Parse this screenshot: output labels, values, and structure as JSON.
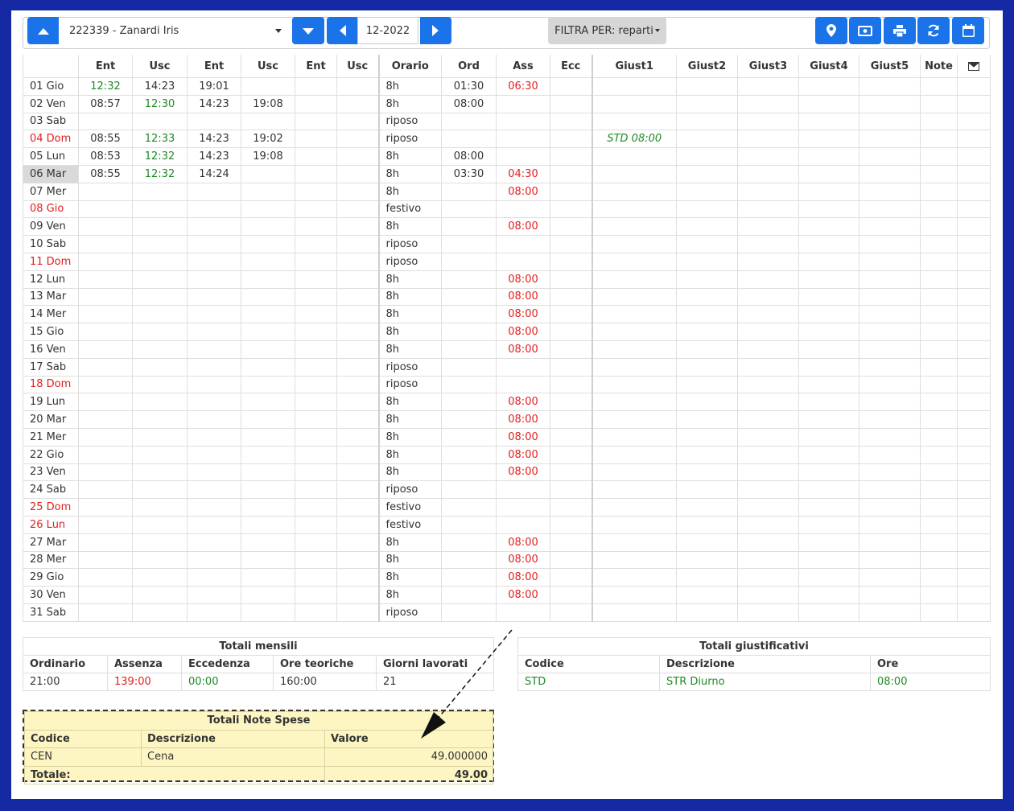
{
  "toolbar": {
    "employee": "222339 - Zanardi Iris",
    "month": "12-2022",
    "filter_label": "FILTRA PER: reparti"
  },
  "icons": {
    "up": "up-arrow-icon",
    "down": "down-arrow-icon",
    "prev": "left-arrow-icon",
    "next": "right-arrow-icon",
    "location": "map-marker-icon",
    "money": "money-bill-icon",
    "print": "print-icon",
    "refresh": "refresh-icon",
    "calendar": "calendar-icon",
    "mail": "envelope-icon"
  },
  "grid": {
    "headers": [
      "",
      "Ent",
      "Usc",
      "Ent",
      "Usc",
      "Ent",
      "Usc",
      "Orario",
      "Ord",
      "Ass",
      "Ecc",
      "Giust1",
      "Giust2",
      "Giust3",
      "Giust4",
      "Giust5",
      "Note",
      ""
    ],
    "selected_day": "06 Mar",
    "rows": [
      {
        "day": "01 Gio",
        "holiday": false,
        "e1": "12:32",
        "e1c": "green",
        "u1": "14:23",
        "e2": "19:01",
        "u2": "",
        "orario": "8h",
        "ord": "01:30",
        "ass": "06:30",
        "giust1": ""
      },
      {
        "day": "02 Ven",
        "holiday": false,
        "e1": "08:57",
        "u1": "12:30",
        "u1c": "green",
        "e2": "14:23",
        "u2": "19:08",
        "orario": "8h",
        "ord": "08:00",
        "ass": "",
        "giust1": ""
      },
      {
        "day": "03 Sab",
        "holiday": false,
        "e1": "",
        "u1": "",
        "e2": "",
        "u2": "",
        "orario": "riposo",
        "ord": "",
        "ass": "",
        "giust1": ""
      },
      {
        "day": "04 Dom",
        "holiday": true,
        "e1": "08:55",
        "u1": "12:33",
        "u1c": "green",
        "e2": "14:23",
        "u2": "19:02",
        "orario": "riposo",
        "ord": "",
        "ass": "",
        "giust1": "STD 08:00"
      },
      {
        "day": "05 Lun",
        "holiday": false,
        "e1": "08:53",
        "u1": "12:32",
        "u1c": "green",
        "e2": "14:23",
        "u2": "19:08",
        "orario": "8h",
        "ord": "08:00",
        "ass": "",
        "giust1": ""
      },
      {
        "day": "06 Mar",
        "holiday": false,
        "e1": "08:55",
        "u1": "12:32",
        "u1c": "green",
        "e2": "14:24",
        "u2": "",
        "orario": "8h",
        "ord": "03:30",
        "ass": "04:30",
        "giust1": ""
      },
      {
        "day": "07 Mer",
        "holiday": false,
        "orario": "8h",
        "ord": "",
        "ass": "08:00"
      },
      {
        "day": "08 Gio",
        "holiday": true,
        "orario": "festivo",
        "ord": "",
        "ass": ""
      },
      {
        "day": "09 Ven",
        "holiday": false,
        "orario": "8h",
        "ord": "",
        "ass": "08:00"
      },
      {
        "day": "10 Sab",
        "holiday": false,
        "orario": "riposo",
        "ord": "",
        "ass": ""
      },
      {
        "day": "11 Dom",
        "holiday": true,
        "orario": "riposo",
        "ord": "",
        "ass": ""
      },
      {
        "day": "12 Lun",
        "holiday": false,
        "orario": "8h",
        "ord": "",
        "ass": "08:00"
      },
      {
        "day": "13 Mar",
        "holiday": false,
        "orario": "8h",
        "ord": "",
        "ass": "08:00"
      },
      {
        "day": "14 Mer",
        "holiday": false,
        "orario": "8h",
        "ord": "",
        "ass": "08:00"
      },
      {
        "day": "15 Gio",
        "holiday": false,
        "orario": "8h",
        "ord": "",
        "ass": "08:00"
      },
      {
        "day": "16 Ven",
        "holiday": false,
        "orario": "8h",
        "ord": "",
        "ass": "08:00"
      },
      {
        "day": "17 Sab",
        "holiday": false,
        "orario": "riposo",
        "ord": "",
        "ass": ""
      },
      {
        "day": "18 Dom",
        "holiday": true,
        "orario": "riposo",
        "ord": "",
        "ass": ""
      },
      {
        "day": "19 Lun",
        "holiday": false,
        "orario": "8h",
        "ord": "",
        "ass": "08:00"
      },
      {
        "day": "20 Mar",
        "holiday": false,
        "orario": "8h",
        "ord": "",
        "ass": "08:00"
      },
      {
        "day": "21 Mer",
        "holiday": false,
        "orario": "8h",
        "ord": "",
        "ass": "08:00"
      },
      {
        "day": "22 Gio",
        "holiday": false,
        "orario": "8h",
        "ord": "",
        "ass": "08:00"
      },
      {
        "day": "23 Ven",
        "holiday": false,
        "orario": "8h",
        "ord": "",
        "ass": "08:00"
      },
      {
        "day": "24 Sab",
        "holiday": false,
        "orario": "riposo",
        "ord": "",
        "ass": ""
      },
      {
        "day": "25 Dom",
        "holiday": true,
        "orario": "festivo",
        "ord": "",
        "ass": ""
      },
      {
        "day": "26 Lun",
        "holiday": true,
        "orario": "festivo",
        "ord": "",
        "ass": ""
      },
      {
        "day": "27 Mar",
        "holiday": false,
        "orario": "8h",
        "ord": "",
        "ass": "08:00"
      },
      {
        "day": "28 Mer",
        "holiday": false,
        "orario": "8h",
        "ord": "",
        "ass": "08:00"
      },
      {
        "day": "29 Gio",
        "holiday": false,
        "orario": "8h",
        "ord": "",
        "ass": "08:00"
      },
      {
        "day": "30 Ven",
        "holiday": false,
        "orario": "8h",
        "ord": "",
        "ass": "08:00"
      },
      {
        "day": "31 Sab",
        "holiday": false,
        "orario": "riposo",
        "ord": "",
        "ass": ""
      }
    ]
  },
  "totali_mensili": {
    "title": "Totali mensili",
    "headers": [
      "Ordinario",
      "Assenza",
      "Eccedenza",
      "Ore teoriche",
      "Giorni lavorati"
    ],
    "values": [
      "21:00",
      "139:00",
      "00:00",
      "160:00",
      "21"
    ]
  },
  "totali_giustificativi": {
    "title": "Totali giustificativi",
    "headers": [
      "Codice",
      "Descrizione",
      "Ore"
    ],
    "values": [
      "STD",
      "STR Diurno",
      "08:00"
    ]
  },
  "totali_note_spese": {
    "title": "Totali Note Spese",
    "headers": [
      "Codice",
      "Descrizione",
      "Valore"
    ],
    "row": [
      "CEN",
      "Cena",
      "49.000000"
    ],
    "total_label": "Totale:",
    "total_value": "49.00"
  },
  "colors": {
    "background": "#1429a3",
    "button": "#1a73e8",
    "holiday": "#e0201f",
    "positive": "#1e8a25",
    "highlight": "#fdf6c3"
  }
}
